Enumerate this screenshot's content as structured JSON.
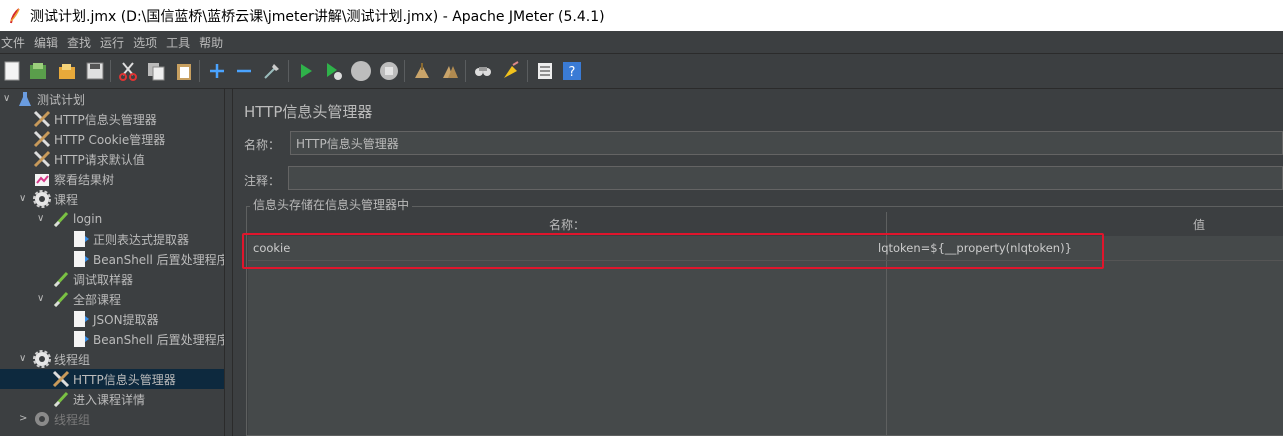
{
  "window": {
    "title": "测试计划.jmx (D:\\国信蓝桥\\蓝桥云课\\jmeter讲解\\测试计划.jmx) - Apache JMeter (5.4.1)"
  },
  "menu": [
    "文件",
    "编辑",
    "查找",
    "运行",
    "选项",
    "工具",
    "帮助"
  ],
  "toolbar": [
    "new-icon",
    "templates-icon",
    "open-icon",
    "save-icon",
    "cut-icon",
    "copy-icon",
    "paste-icon",
    "expand-icon",
    "collapse-icon",
    "toggle-icon",
    "start-icon",
    "start-no-pause-icon",
    "stop-icon",
    "shutdown-icon",
    "clear-icon",
    "clear-all-icon",
    "search-icon",
    "reset-search-icon",
    "function-helper-icon",
    "help-icon"
  ],
  "tree": [
    {
      "label": "测试计划",
      "icon": "flask-icon"
    },
    {
      "label": "HTTP信息头管理器",
      "icon": "config-element-icon"
    },
    {
      "label": "HTTP Cookie管理器",
      "icon": "config-element-icon"
    },
    {
      "label": "HTTP请求默认值",
      "icon": "config-element-icon"
    },
    {
      "label": "察看结果树",
      "icon": "listener-icon"
    },
    {
      "label": "课程",
      "icon": "thread-group-icon"
    },
    {
      "label": "login",
      "icon": "sampler-icon"
    },
    {
      "label": "正则表达式提取器",
      "icon": "post-processor-icon"
    },
    {
      "label": "BeanShell 后置处理程序",
      "icon": "post-processor-icon"
    },
    {
      "label": "调试取样器",
      "icon": "sampler-icon"
    },
    {
      "label": "全部课程",
      "icon": "sampler-icon"
    },
    {
      "label": "JSON提取器",
      "icon": "post-processor-icon"
    },
    {
      "label": "BeanShell 后置处理程序",
      "icon": "post-processor-icon"
    },
    {
      "label": "线程组",
      "icon": "thread-group-icon"
    },
    {
      "label": "HTTP信息头管理器",
      "icon": "config-element-icon"
    },
    {
      "label": "进入课程详情",
      "icon": "sampler-icon"
    },
    {
      "label": "线程组",
      "icon": "thread-group-icon"
    }
  ],
  "panel": {
    "title": "HTTP信息头管理器",
    "name_label": "名称：",
    "name_value": "HTTP信息头管理器",
    "comment_label": "注释：",
    "comment_value": "",
    "group_title": "信息头存储在信息头管理器中",
    "columns": [
      "名称：",
      "值"
    ],
    "rows": [
      {
        "name": "cookie",
        "value": "lqtoken=${__property(nlqtoken)}"
      }
    ]
  },
  "colors": {
    "background": "#3c3f41",
    "selection": "#0d293e",
    "highlight": "#e0152c"
  }
}
